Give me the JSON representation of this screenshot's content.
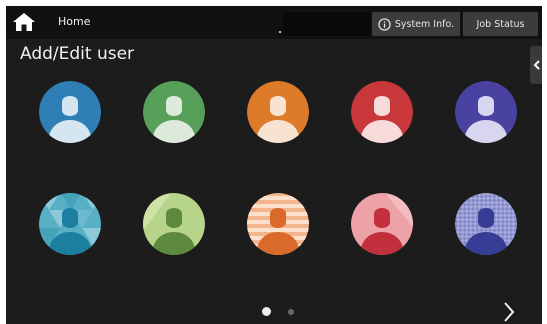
{
  "topbar": {
    "home_label": "Home",
    "system_info_label": "System Info.",
    "job_status_label": "Job Status"
  },
  "page": {
    "title": "Add/Edit user"
  },
  "icons": {
    "home": "home-icon",
    "info": "info-icon",
    "side_collapse": "chevron-left-icon",
    "next": "chevron-right-icon"
  },
  "avatars": [
    {
      "row": 1,
      "bg": "#2f7fb6",
      "person": "#d6e6f0",
      "pattern": "solid"
    },
    {
      "row": 1,
      "bg": "#57a05a",
      "person": "#ddeadb",
      "pattern": "solid"
    },
    {
      "row": 1,
      "bg": "#dd7b2a",
      "person": "#f8e3d3",
      "pattern": "solid"
    },
    {
      "row": 1,
      "bg": "#c8383a",
      "person": "#f7dada",
      "pattern": "solid"
    },
    {
      "row": 1,
      "bg": "#4a42a0",
      "person": "#d8d6ef",
      "pattern": "solid"
    },
    {
      "row": 2,
      "bg": "#58b0c6",
      "person": "#1d7f9f",
      "pattern": "triangles"
    },
    {
      "row": 2,
      "bg": "#b6d48a",
      "person": "#5d8a3e",
      "pattern": "solid"
    },
    {
      "row": 2,
      "bg": "#f4b58c",
      "person": "#d96a2c",
      "pattern": "stripes"
    },
    {
      "row": 2,
      "bg": "#eda2a8",
      "person": "#c3303d",
      "pattern": "solid"
    },
    {
      "row": 2,
      "bg": "#8288c8",
      "person": "#353d94",
      "pattern": "checker"
    }
  ],
  "pagination": {
    "pages": 2,
    "current": 1
  }
}
